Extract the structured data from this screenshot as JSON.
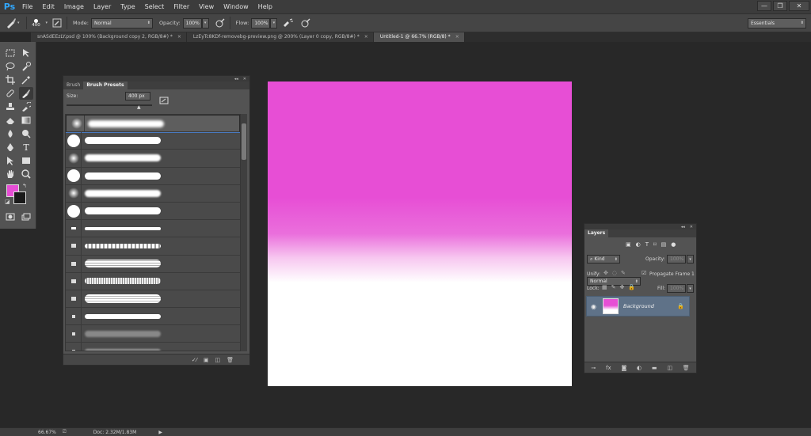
{
  "app": {
    "logo": "Ps",
    "win_min": "—",
    "win_max": "❐",
    "win_close": "✕"
  },
  "menu": [
    "File",
    "Edit",
    "Image",
    "Layer",
    "Type",
    "Select",
    "Filter",
    "View",
    "Window",
    "Help"
  ],
  "options": {
    "brush_size": "400",
    "mode_label": "Mode:",
    "mode_value": "Normal",
    "opacity_label": "Opacity:",
    "opacity_value": "100%",
    "flow_label": "Flow:",
    "flow_value": "100%",
    "workspace": "Essentials"
  },
  "tabs": [
    {
      "label": "snASdEEzLY.psd @ 100% (Background copy 2, RGB/8#) *",
      "close": "×"
    },
    {
      "label": "LzEyTc8KDf-removebg-preview.png @ 200% (Layer 0 copy, RGB/8#) *",
      "close": "×"
    },
    {
      "label": "Untitled-1 @ 66.7% (RGB/8) *",
      "close": "×"
    }
  ],
  "colors": {
    "foreground": "#e74ed5",
    "background": "#1a1a1a",
    "accent": "#5f7288"
  },
  "brush_panel": {
    "tab_brush": "Brush",
    "tab_presets": "Brush Presets",
    "size_label": "Size:",
    "size_value": "400 px",
    "collapse": "◂◂",
    "close": "✕"
  },
  "layers_panel": {
    "title": "Layers",
    "filter_kind": "Kind",
    "blend_mode": "Normal",
    "opacity_label": "Opacity:",
    "opacity_value": "100%",
    "unify_label": "Unify:",
    "propagate_label": "Propagate Frame 1",
    "lock_label": "Lock:",
    "fill_label": "Fill:",
    "fill_value": "100%",
    "layer_name": "Background",
    "collapse": "◂◂",
    "close": "✕"
  },
  "status": {
    "zoom": "66.67%",
    "doc": "Doc: 2.32M/1.83M",
    "arrow": "▶"
  }
}
